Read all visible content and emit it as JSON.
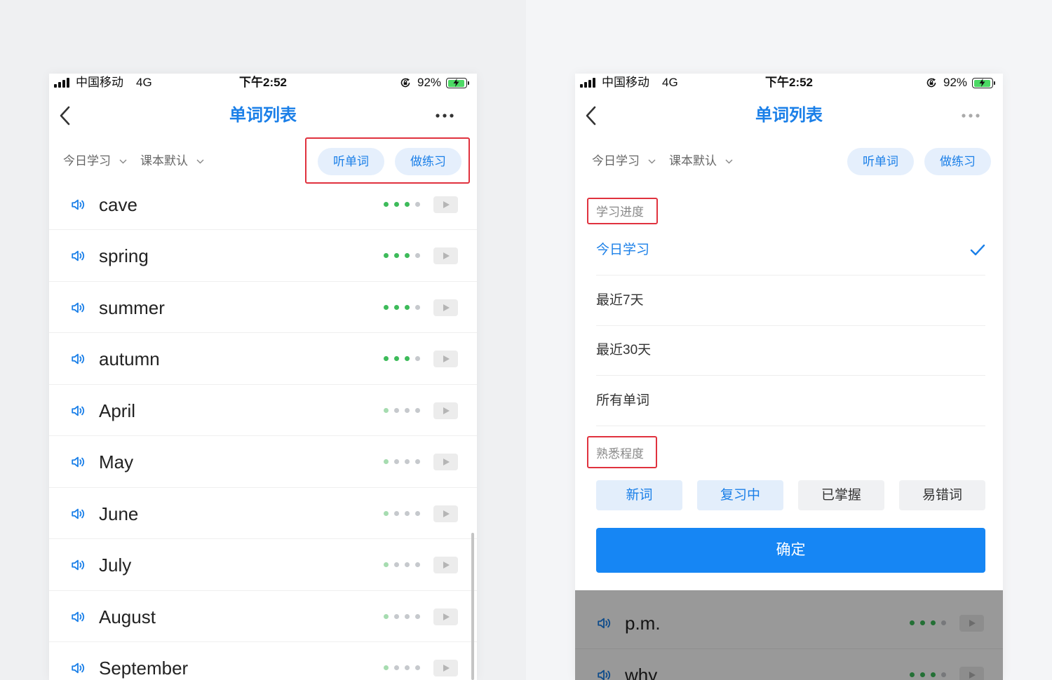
{
  "status_bar": {
    "carrier": "中国移动",
    "network": "4G",
    "time": "下午2:52",
    "battery": "92%"
  },
  "nav": {
    "title": "单词列表",
    "back_icon": "chevron-left-icon",
    "more_icon": "more-icon"
  },
  "filters": {
    "period": "今日学习",
    "textbook": "课本默认"
  },
  "actions": {
    "listen": "听单词",
    "practice": "做练习"
  },
  "mastery_max": 4,
  "word_list": [
    {
      "word": "cave",
      "mastery": 3
    },
    {
      "word": "spring",
      "mastery": 3
    },
    {
      "word": "summer",
      "mastery": 3
    },
    {
      "word": "autumn",
      "mastery": 3
    },
    {
      "word": "April",
      "mastery": 1
    },
    {
      "word": "May",
      "mastery": 1
    },
    {
      "word": "June",
      "mastery": 1
    },
    {
      "word": "July",
      "mastery": 1
    },
    {
      "word": "August",
      "mastery": 1
    },
    {
      "word": "September",
      "mastery": 1
    }
  ],
  "filter_panel": {
    "progress_title": "学习进度",
    "progress_options": [
      {
        "label": "今日学习",
        "selected": true
      },
      {
        "label": "最近7天",
        "selected": false
      },
      {
        "label": "最近30天",
        "selected": false
      },
      {
        "label": "所有单词",
        "selected": false
      }
    ],
    "familiarity_title": "熟悉程度",
    "familiarity_chips": [
      {
        "label": "新词",
        "selected": true
      },
      {
        "label": "复习中",
        "selected": true
      },
      {
        "label": "已掌握",
        "selected": false
      },
      {
        "label": "易错词",
        "selected": false
      }
    ],
    "confirm": "确定"
  },
  "background_word_list": [
    {
      "word": "p.m.",
      "mastery": 3
    },
    {
      "word": "why",
      "mastery": 3
    }
  ],
  "colors": {
    "accent": "#1a7fe8",
    "primary_button": "#1686f4",
    "mastery_high": "#3dbb5a",
    "mastery_low": "#a6dcb0",
    "mastery_empty": "#c6c9cd",
    "annotation_box": "#e0323e"
  }
}
